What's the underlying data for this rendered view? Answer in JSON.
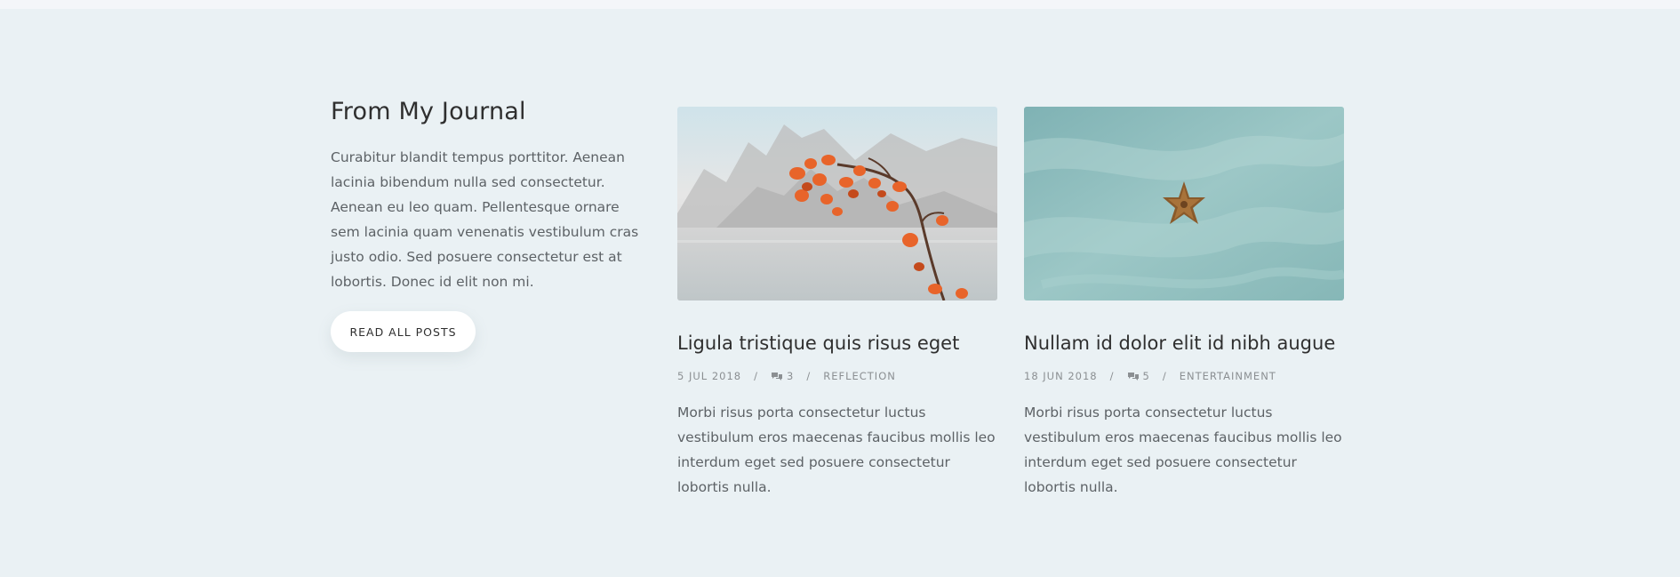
{
  "journal": {
    "heading": "From My Journal",
    "description": "Curabitur blandit tempus porttitor. Aenean lacinia bibendum nulla sed consectetur. Aenean eu leo quam. Pellentesque ornare sem lacinia quam venenatis vestibulum cras justo odio. Sed posuere consectetur est at lobortis. Donec id elit non mi.",
    "button_label": "READ ALL POSTS"
  },
  "posts": [
    {
      "title": "Ligula tristique quis risus eget",
      "date": "5 JUL 2018",
      "separator": "/",
      "comments": "3",
      "comment_icon": "comments-icon",
      "category": "REFLECTION",
      "excerpt": "Morbi risus porta consectetur luctus vestibulum eros maecenas faucibus mollis leo interdum eget sed posuere consectetur lobortis nulla.",
      "image": "autumn-branch-over-lake"
    },
    {
      "title": "Nullam id dolor elit id nibh augue",
      "date": "18 JUN 2018",
      "separator": "/",
      "comments": "5",
      "comment_icon": "comments-icon",
      "category": "ENTERTAINMENT",
      "excerpt": "Morbi risus porta consectetur luctus vestibulum eros maecenas faucibus mollis leo interdum eget sed posuere consectetur lobortis nulla.",
      "image": "starfish-on-sand"
    }
  ],
  "colors": {
    "section_bg": "#eaf1f4",
    "heading": "#2f2f2f",
    "body_text": "#5d6266",
    "meta_text": "#8b8f92",
    "leaf_orange": "#e8642a",
    "sand_teal": "#8fbcbc"
  }
}
